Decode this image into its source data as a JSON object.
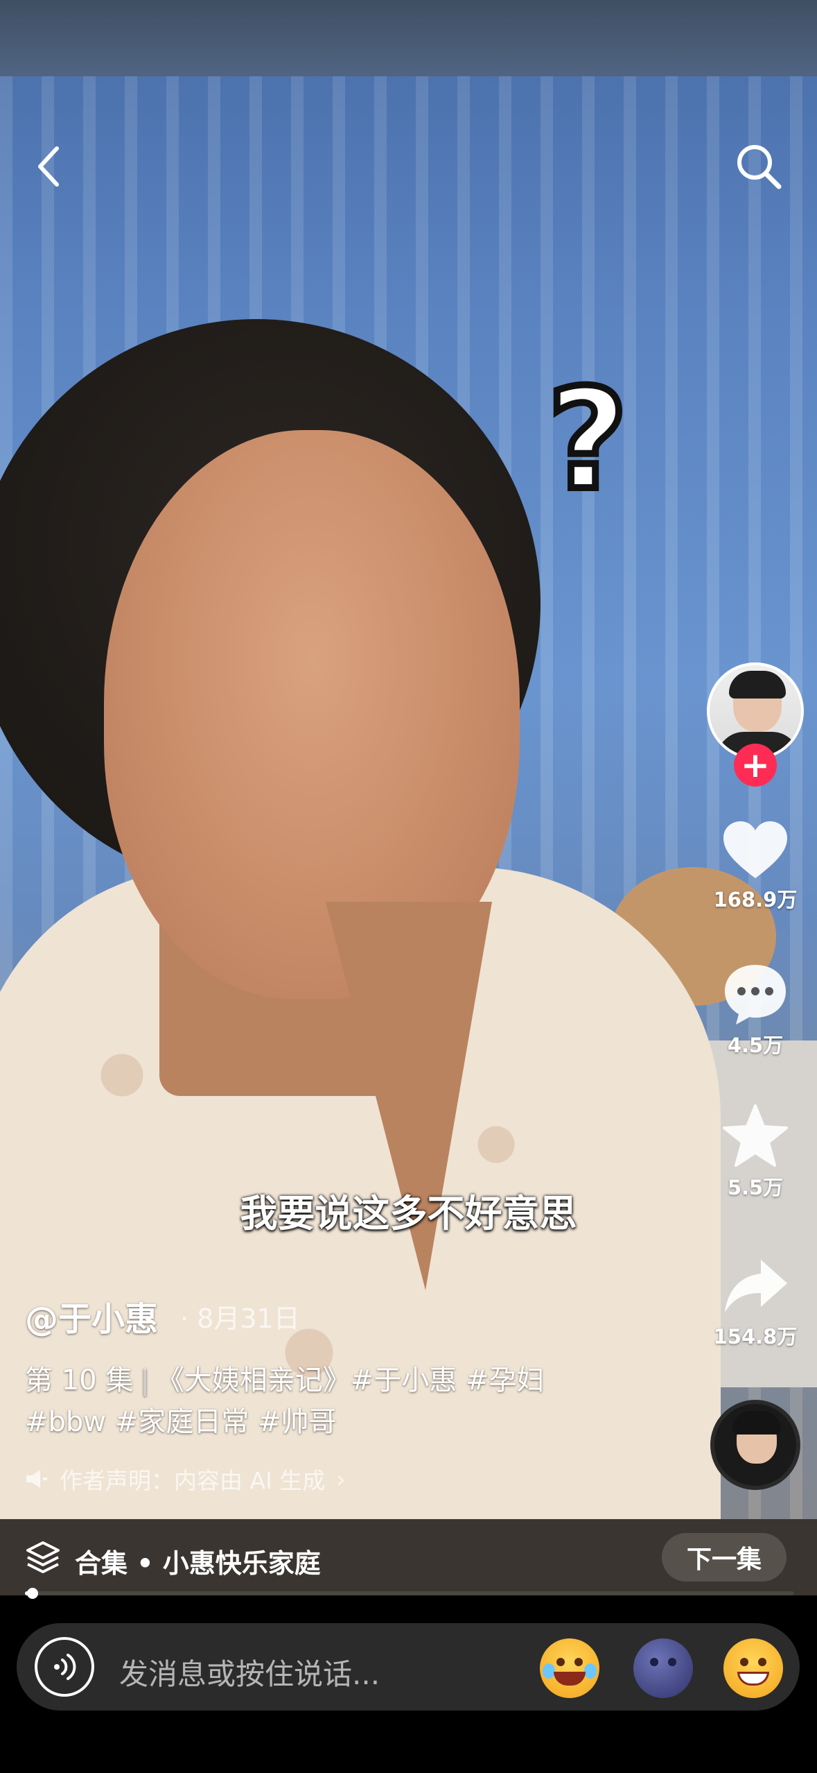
{
  "video": {
    "subtitle": "我要说这多不好意思",
    "author": "@于小惠",
    "date_sep": "·",
    "date": "8月31日",
    "description_line1_parts": [
      "第 10 集",
      "|",
      "《大姨相亲记》#于小惠 #孕妇"
    ],
    "description_line2": "#bbw #家庭日常 #帅哥",
    "notice": "作者声明：内容由 AI 生成",
    "notice_chevron": "›"
  },
  "actions": {
    "likes": "168.9万",
    "comments": "4.5万",
    "favorites": "5.5万",
    "shares": "154.8万",
    "follow_symbol": "+"
  },
  "collection": {
    "label": "合集 • 小惠快乐家庭",
    "next_button": "下一集",
    "progress_fraction": 0.01
  },
  "message_bar": {
    "placeholder": "发消息或按住说话..."
  },
  "icons": [
    "back-icon",
    "search-icon",
    "question-mark-sticker",
    "heart-icon",
    "comment-icon",
    "star-icon",
    "share-icon",
    "speaker-icon",
    "stack-icon",
    "voice-icon",
    "laugh-cry-emoji",
    "moon-emoji",
    "grin-emoji"
  ],
  "colors": {
    "follow": "#fe2c55",
    "bottom_bar": "#000000",
    "input_bg": "#2b2b2b"
  }
}
